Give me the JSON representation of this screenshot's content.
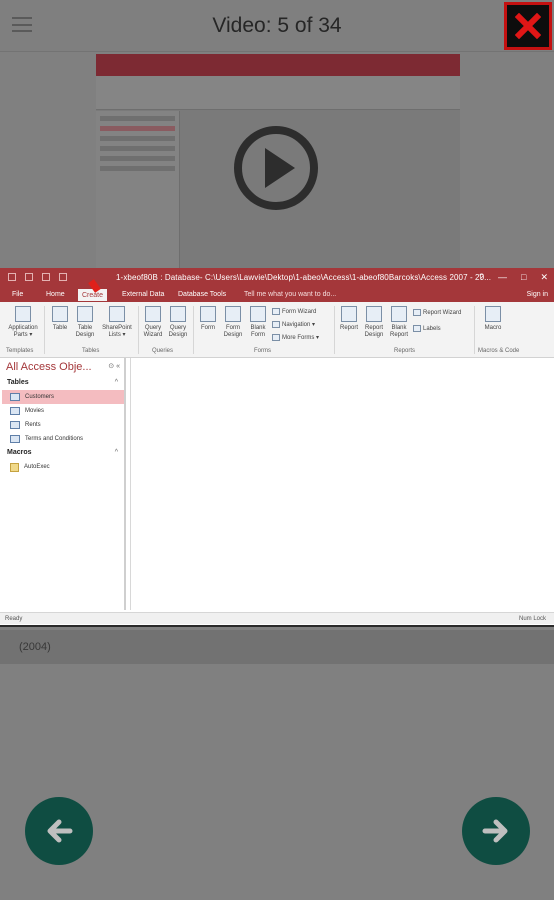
{
  "header": {
    "title": "Video: 5 of 34",
    "menu_icon": "hamburger-icon",
    "close_icon": "close-x-icon"
  },
  "video": {
    "play_icon": "play-icon"
  },
  "access_window": {
    "title": "1-xbeof80B : Database- C:\\Users\\Lawvie\\Dektop\\1-abeo\\Access\\1-abeof80Barcoks\\Access 2007 - 20...",
    "window_controls": [
      "?",
      "—",
      "□",
      "✕"
    ],
    "tabs": [
      "File",
      "Home",
      "Create",
      "External Data",
      "Database Tools"
    ],
    "tell_me": "Tell me what you want to do...",
    "sign_in": "Sign in",
    "ribbon": {
      "buttons": [
        {
          "label": "Application\nParts ▾"
        },
        {
          "label": "Table"
        },
        {
          "label": "Table\nDesign"
        },
        {
          "label": "SharePoint\nLists ▾"
        },
        {
          "label": "Query\nWizard"
        },
        {
          "label": "Query\nDesign"
        },
        {
          "label": "Form"
        },
        {
          "label": "Form\nDesign"
        },
        {
          "label": "Blank\nForm"
        },
        {
          "label": "Report"
        },
        {
          "label": "Report\nDesign"
        },
        {
          "label": "Blank\nReport"
        },
        {
          "label": "Macro"
        }
      ],
      "small_items": [
        "Form Wizard",
        "Navigation ▾",
        "More Forms ▾",
        "Report Wizard",
        "Labels"
      ],
      "groups": [
        "Templates",
        "Tables",
        "Queries",
        "Forms",
        "Reports",
        "Macros & Code"
      ]
    },
    "nav_pane": {
      "title": "All Access Obje...",
      "sections": [
        {
          "title": "Tables",
          "items": [
            "Customers",
            "Movies",
            "Rents",
            "Terms and Conditions"
          ]
        },
        {
          "title": "Macros",
          "items": [
            "AutoExec"
          ]
        }
      ]
    },
    "status_left": "Ready",
    "status_right": "Num Lock"
  },
  "caption": "(2004)",
  "nav": {
    "prev_icon": "arrow-left-icon",
    "next_icon": "arrow-right-icon"
  },
  "colors": {
    "overlay": "#808080",
    "access_accent": "#a4373a",
    "nav_button": "#0f4d42",
    "close_border": "#c41111"
  }
}
